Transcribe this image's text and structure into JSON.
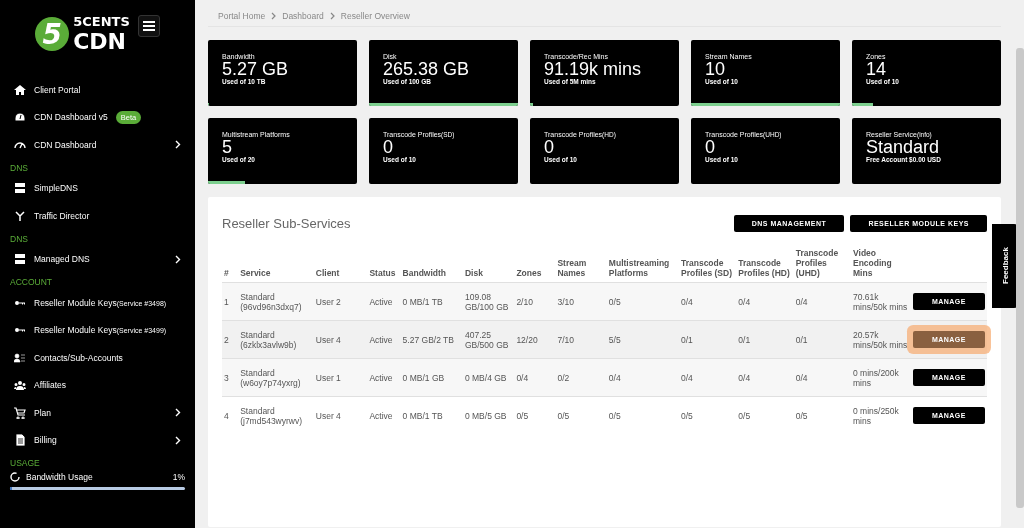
{
  "logo": {
    "digit": "5",
    "line1": "5CENTS",
    "line2": "CDN"
  },
  "sidebar": {
    "items": [
      {
        "kind": "link",
        "label": "Client Portal",
        "expandable": false
      },
      {
        "kind": "link",
        "label": "CDN Dashboard v5",
        "badge": "Beta",
        "expandable": false
      },
      {
        "kind": "link",
        "label": "CDN Dashboard",
        "expandable": true
      },
      {
        "kind": "header",
        "label": "DNS"
      },
      {
        "kind": "link",
        "label": "SimpleDNS",
        "expandable": false
      },
      {
        "kind": "link",
        "label": "Traffic Director",
        "expandable": false
      },
      {
        "kind": "header",
        "label": "DNS"
      },
      {
        "kind": "link",
        "label": "Managed DNS",
        "expandable": true
      },
      {
        "kind": "header",
        "label": "ACCOUNT"
      },
      {
        "kind": "link",
        "label": "Reseller Module Keys",
        "note": "(Service #3498)",
        "expandable": false
      },
      {
        "kind": "link",
        "label": "Reseller Module Keys",
        "note": "(Service #3499)",
        "expandable": false
      },
      {
        "kind": "link",
        "label": "Contacts/Sub-Accounts",
        "expandable": false
      },
      {
        "kind": "link",
        "label": "Affiliates",
        "expandable": false
      },
      {
        "kind": "link",
        "label": "Plan",
        "expandable": true
      },
      {
        "kind": "link",
        "label": "Billing",
        "expandable": true
      },
      {
        "kind": "header",
        "label": "USAGE"
      }
    ],
    "usage": {
      "label": "Bandwidth Usage",
      "reading": "1%",
      "level": 0.01
    }
  },
  "breadcrumb": [
    "Portal Home",
    "Dashboard",
    "Reseller Overview"
  ],
  "stats": [
    {
      "title": "Bandwidth",
      "value": "5.27 GB",
      "sub": "Used of 10 TB",
      "level": 0.01
    },
    {
      "title": "Disk",
      "value": "265.38 GB",
      "sub": "Used of 100 GB",
      "level": 1
    },
    {
      "title": "Transcode/Rec Mins",
      "value": "91.19k mins",
      "sub": "Used of 5M mins",
      "level": 0.02
    },
    {
      "title": "Stream Names",
      "value": "10",
      "sub": "Used of 10",
      "level": 1
    },
    {
      "title": "Zones",
      "value": "14",
      "sub": "Used of 10",
      "level": 0.14
    },
    {
      "title": "Multistream Platforms",
      "value": "5",
      "sub": "Used of 20",
      "level": 0.25
    },
    {
      "title": "Transcode Profiles",
      "note": "(SD)",
      "value": "0",
      "sub": "Used of 10"
    },
    {
      "title": "Transcode Profiles",
      "note": "(HD)",
      "value": "0",
      "sub": "Used of 10"
    },
    {
      "title": "Transcode Profiles",
      "note": "(UHD)",
      "value": "0",
      "sub": "Used of 10"
    },
    {
      "title": "Reseller Service",
      "note": "(info)",
      "value": "Standard",
      "sub": "Free Account $0.00 USD"
    }
  ],
  "panel": {
    "title": "Reseller Sub-Services",
    "buttons": [
      "DNS MANAGEMENT",
      "RESELLER MODULE KEYS"
    ],
    "columns": [
      "#",
      "Service",
      "Client",
      "Status",
      "Bandwidth",
      "Disk",
      "Zones",
      "Stream Names",
      "Multistreaming Platforms",
      "Transcode Profiles (SD)",
      "Transcode Profiles (HD)",
      "Transcode Profiles (UHD)",
      "Video Encoding Mins"
    ],
    "rows": [
      {
        "cells": [
          "1",
          "Standard (96vd96n3dxq7)",
          "User 2",
          "Active",
          "0 MB/1 TB",
          "109.08 GB/100 GB",
          "2/10",
          "3/10",
          "0/5",
          "0/4",
          "0/4",
          "0/4",
          "70.61k mins/50k mins"
        ],
        "action": "MANAGE",
        "pressed": false
      },
      {
        "cells": [
          "2",
          "Standard (6zklx3avlw9b)",
          "User 4",
          "Active",
          "5.27 GB/2 TB",
          "407.25 GB/500 GB",
          "12/20",
          "7/10",
          "5/5",
          "0/1",
          "0/1",
          "0/1",
          "20.57k mins/50k mins"
        ],
        "action": "MANAGE",
        "pressed": true
      },
      {
        "cells": [
          "3",
          "Standard (w6oy7p74yxrg)",
          "User 1",
          "Active",
          "0 MB/1 GB",
          "0 MB/4 GB",
          "0/4",
          "0/2",
          "0/4",
          "0/4",
          "0/4",
          "0/4",
          "0 mins/200k mins"
        ],
        "action": "MANAGE",
        "pressed": false
      },
      {
        "cells": [
          "4",
          "Standard (j7md543wyrwv)",
          "User 4",
          "Active",
          "0 MB/1 TB",
          "0 MB/5 GB",
          "0/5",
          "0/5",
          "0/5",
          "0/5",
          "0/5",
          "0/5",
          "0 mins/250k mins"
        ],
        "action": "MANAGE",
        "pressed": false
      }
    ]
  },
  "feedback": "Feedback"
}
